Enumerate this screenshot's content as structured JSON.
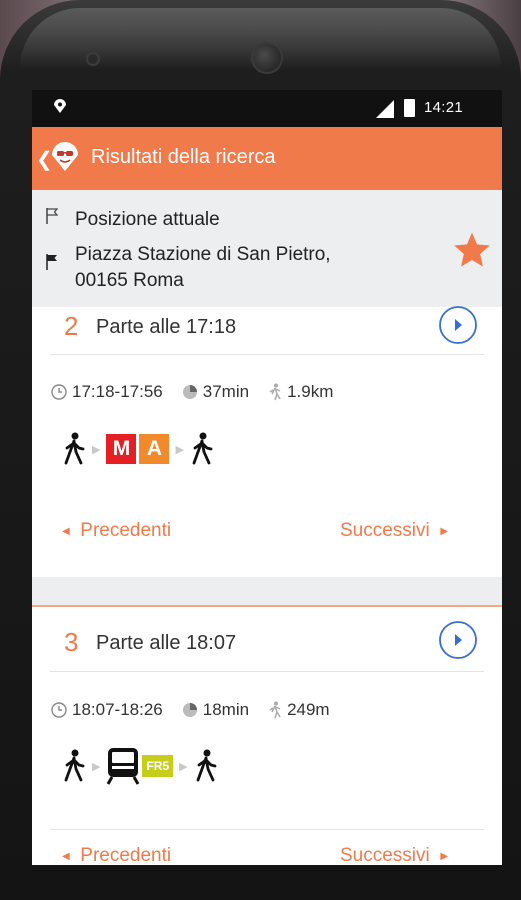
{
  "status_bar": {
    "time": "14:21"
  },
  "app_bar": {
    "back_icon": "chevron-left-icon",
    "logo": "app-logo",
    "title": "Risultati della ricerca"
  },
  "route": {
    "from": "Posizione attuale",
    "to_line1": "Piazza Stazione di San Pietro,",
    "to_line2": "00165 Roma",
    "favorite_icon": "star-icon"
  },
  "results": [
    {
      "number": "2",
      "departure": "Parte alle 17:18",
      "time_range": "17:18-17:56",
      "duration": "37min",
      "walk_distance": "1.9km",
      "legs": [
        "walk",
        "metro",
        "walk"
      ],
      "metro_line_m": "M",
      "metro_line_a": "A",
      "prev_label": "Precedenti",
      "next_label": "Successivi"
    },
    {
      "number": "3",
      "departure": "Parte alle 18:07",
      "time_range": "18:07-18:26",
      "duration": "18min",
      "walk_distance": "249m",
      "legs": [
        "walk",
        "train",
        "walk"
      ],
      "train_line": "FR5",
      "prev_label": "Precedenti",
      "next_label": "Successivi"
    }
  ],
  "colors": {
    "accent": "#f07a4a",
    "metro_red": "#e42025",
    "metro_a": "#f08a2a",
    "fr_line": "#c5cf1a"
  }
}
